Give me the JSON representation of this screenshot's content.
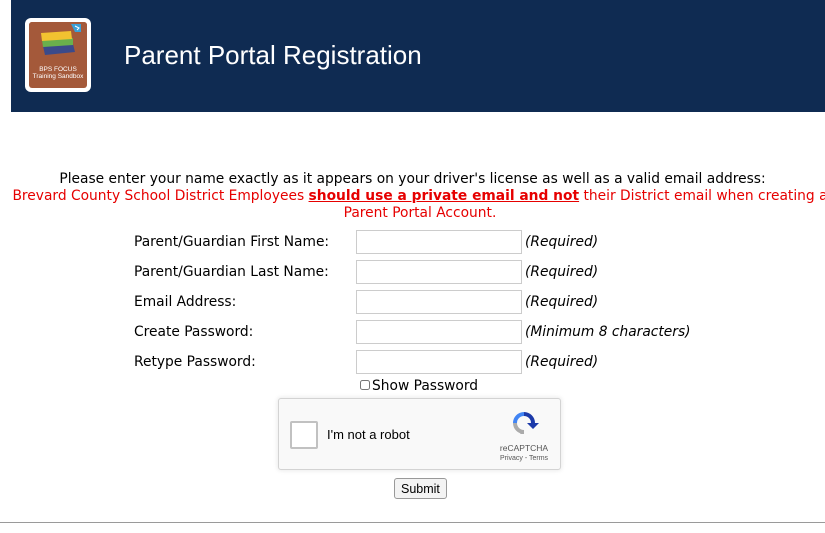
{
  "header": {
    "title": "Parent Portal Registration",
    "logo_text": "BPS FOCUS Training Sandbox",
    "background_color": "#0f2b52"
  },
  "intro_text": "Please enter your name exactly as it appears on your driver's license as well as a valid email address:",
  "warning": {
    "part1": "Brevard County School District Employees ",
    "emphasis": "should use a private email and not",
    "part2": " their District email when creating a Parent Portal Account.",
    "color": "#e60000"
  },
  "form": {
    "fields": [
      {
        "label": "Parent/Guardian First Name:",
        "value": "",
        "hint": "(Required)"
      },
      {
        "label": "Parent/Guardian Last Name:",
        "value": "",
        "hint": "(Required)"
      },
      {
        "label": "Email Address:",
        "value": "",
        "hint": "(Required)"
      },
      {
        "label": "Create Password:",
        "value": "",
        "hint": "(Minimum 8 characters)"
      },
      {
        "label": "Retype Password:",
        "value": "",
        "hint": "(Required)"
      }
    ],
    "show_password_label": "Show Password",
    "submit_label": "Submit"
  },
  "captcha": {
    "label": "I'm not a robot",
    "brand": "reCAPTCHA",
    "links": "Privacy - Terms"
  }
}
